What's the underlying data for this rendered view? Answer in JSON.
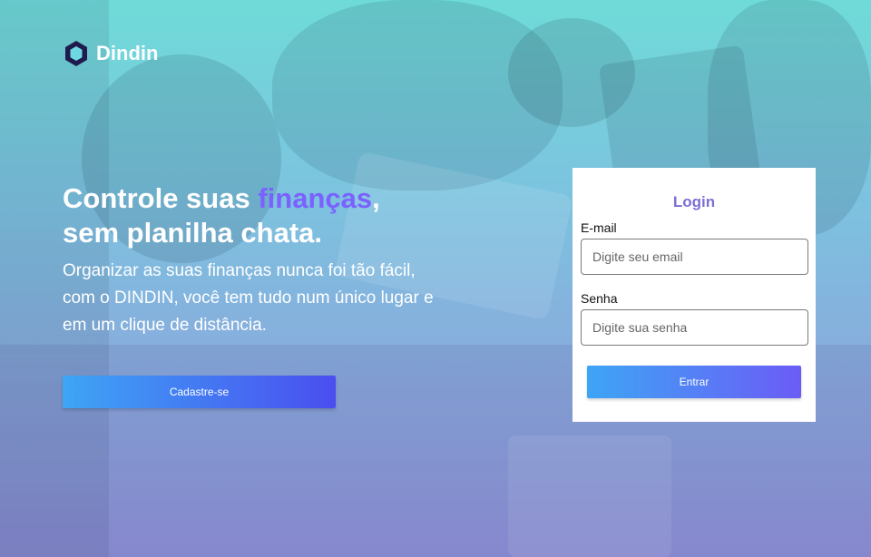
{
  "brand": {
    "name": "Dindin",
    "icon": "hexagon-logo-icon"
  },
  "hero": {
    "headline_part1": "Controle suas ",
    "headline_accent": "finanças",
    "headline_part2": ",",
    "headline_line2": "sem planilha chata.",
    "subtitle": "Organizar as suas finanças nunca foi tão fácil, com o DINDIN, você tem tudo num único lugar e em um clique de distância.",
    "signup_label": "Cadastre-se"
  },
  "login": {
    "title": "Login",
    "email_label": "E-mail",
    "email_placeholder": "Digite seu email",
    "email_value": "",
    "password_label": "Senha",
    "password_placeholder": "Digite sua senha",
    "password_value": "",
    "submit_label": "Entrar"
  },
  "colors": {
    "accent": "#7b61ff",
    "login_title": "#7b6fd6",
    "button_start": "#3ea5f5",
    "button_end": "#4a4ef0"
  }
}
